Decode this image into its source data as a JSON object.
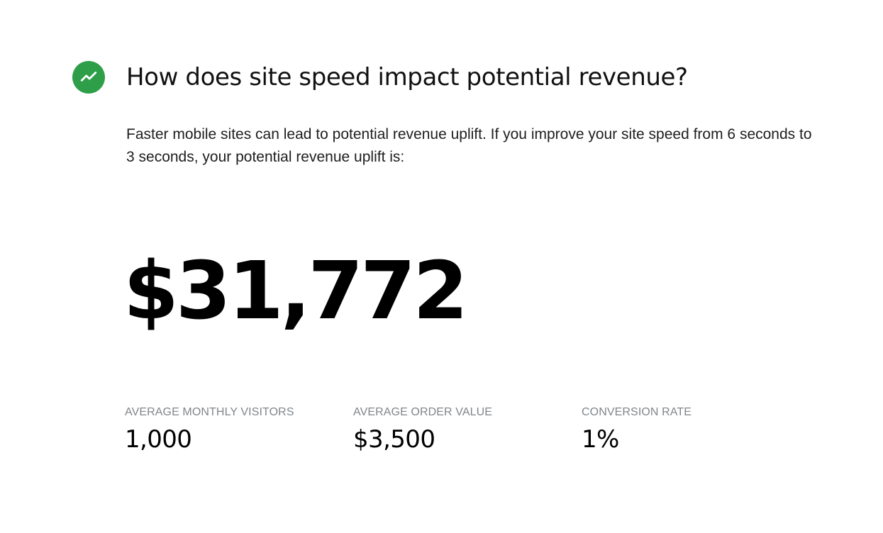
{
  "section": {
    "icon": "trending-up-icon",
    "icon_bg_color": "#2e9e48",
    "heading": "How does site speed impact potential revenue?",
    "description": "Faster mobile sites can lead to potential revenue uplift. If you improve your site speed from 6 seconds to 3 seconds, your potential revenue uplift is:",
    "revenue_uplift": "$31,772"
  },
  "stats": {
    "visitors": {
      "label": "AVERAGE MONTHLY VISITORS",
      "value": "1,000"
    },
    "order_value": {
      "label": "AVERAGE ORDER VALUE",
      "value": "$3,500"
    },
    "conversion_rate": {
      "label": "CONVERSION RATE",
      "value": "1%"
    }
  }
}
